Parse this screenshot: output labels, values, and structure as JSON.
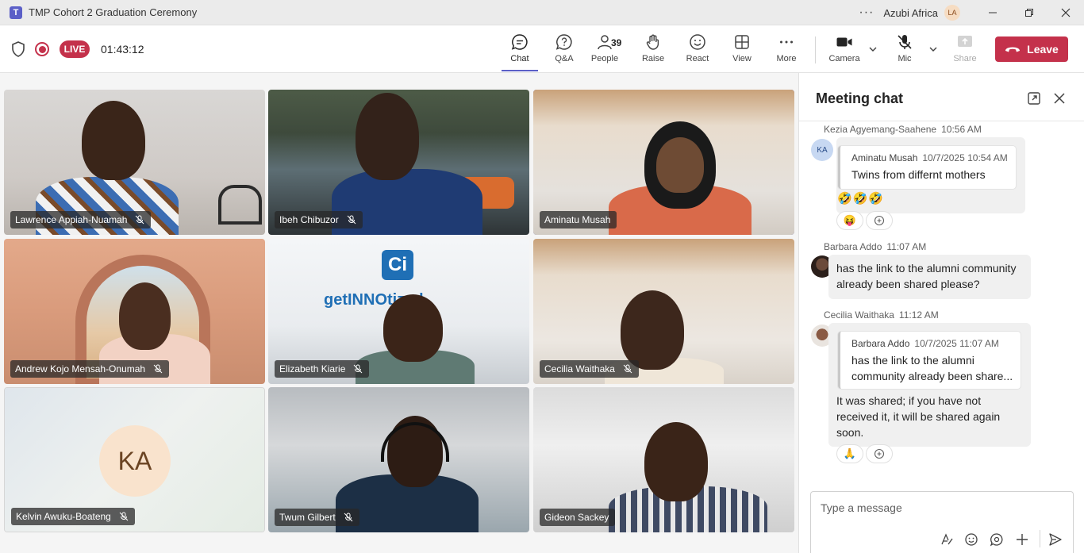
{
  "window": {
    "title": "TMP Cohort 2 Graduation Ceremony",
    "org_name": "Azubi Africa",
    "org_initials": "LA",
    "logo_glyph": "T"
  },
  "toolbar": {
    "live_label": "LIVE",
    "timer": "01:43:12",
    "chat_label": "Chat",
    "qa_label": "Q&A",
    "people_label": "People",
    "people_count": "39",
    "raise_label": "Raise",
    "react_label": "React",
    "view_label": "View",
    "more_label": "More",
    "camera_label": "Camera",
    "mic_label": "Mic",
    "share_label": "Share",
    "leave_label": "Leave",
    "accent_color": "#5b5fc7",
    "danger_color": "#c4314b"
  },
  "participants": [
    {
      "name": "Lawrence Appiah-Nuamah",
      "muted": true
    },
    {
      "name": "Ibeh Chibuzor",
      "muted": true
    },
    {
      "name": "Aminatu Musah",
      "muted": false,
      "speaking": true
    },
    {
      "name": "Andrew Kojo Mensah-Onumah",
      "muted": true
    },
    {
      "name": "Elizabeth Kiarie",
      "muted": true,
      "background_text": "getINNOtized"
    },
    {
      "name": "Cecilia Waithaka",
      "muted": true
    },
    {
      "name": "Kelvin Awuku-Boateng",
      "muted": true,
      "initials": "KA",
      "video_off": true
    },
    {
      "name": "Twum Gilbert",
      "muted": true
    },
    {
      "name": "Gideon Sackey",
      "muted": false
    }
  ],
  "chat": {
    "title": "Meeting chat",
    "messages": [
      {
        "author": "Kezia Agyemang-Saahene",
        "time": "10:56 AM",
        "avatar_initials": "KA",
        "quote_author": "Aminatu Musah",
        "quote_time": "10/7/2025 10:54 AM",
        "quote_text": "Twins from differnt mothers",
        "emojis": "🤣🤣🤣",
        "reaction": "😝"
      },
      {
        "author": "Barbara Addo",
        "time": "11:07 AM",
        "text_line1": "has the link to the alumni community",
        "text_line2": "already been shared please?"
      },
      {
        "author": "Cecilia Waithaka",
        "time": "11:12 AM",
        "quote_author": "Barbara Addo",
        "quote_time": "10/7/2025 11:07 AM",
        "quote_line1": "has the link to the alumni",
        "quote_line2": "community already been share...",
        "text_line1": "It was shared; if you have not",
        "text_line2": "received it, it will be shared again",
        "text_line3": "soon.",
        "reaction": "🙏"
      }
    ],
    "composer_placeholder": "Type a message"
  }
}
